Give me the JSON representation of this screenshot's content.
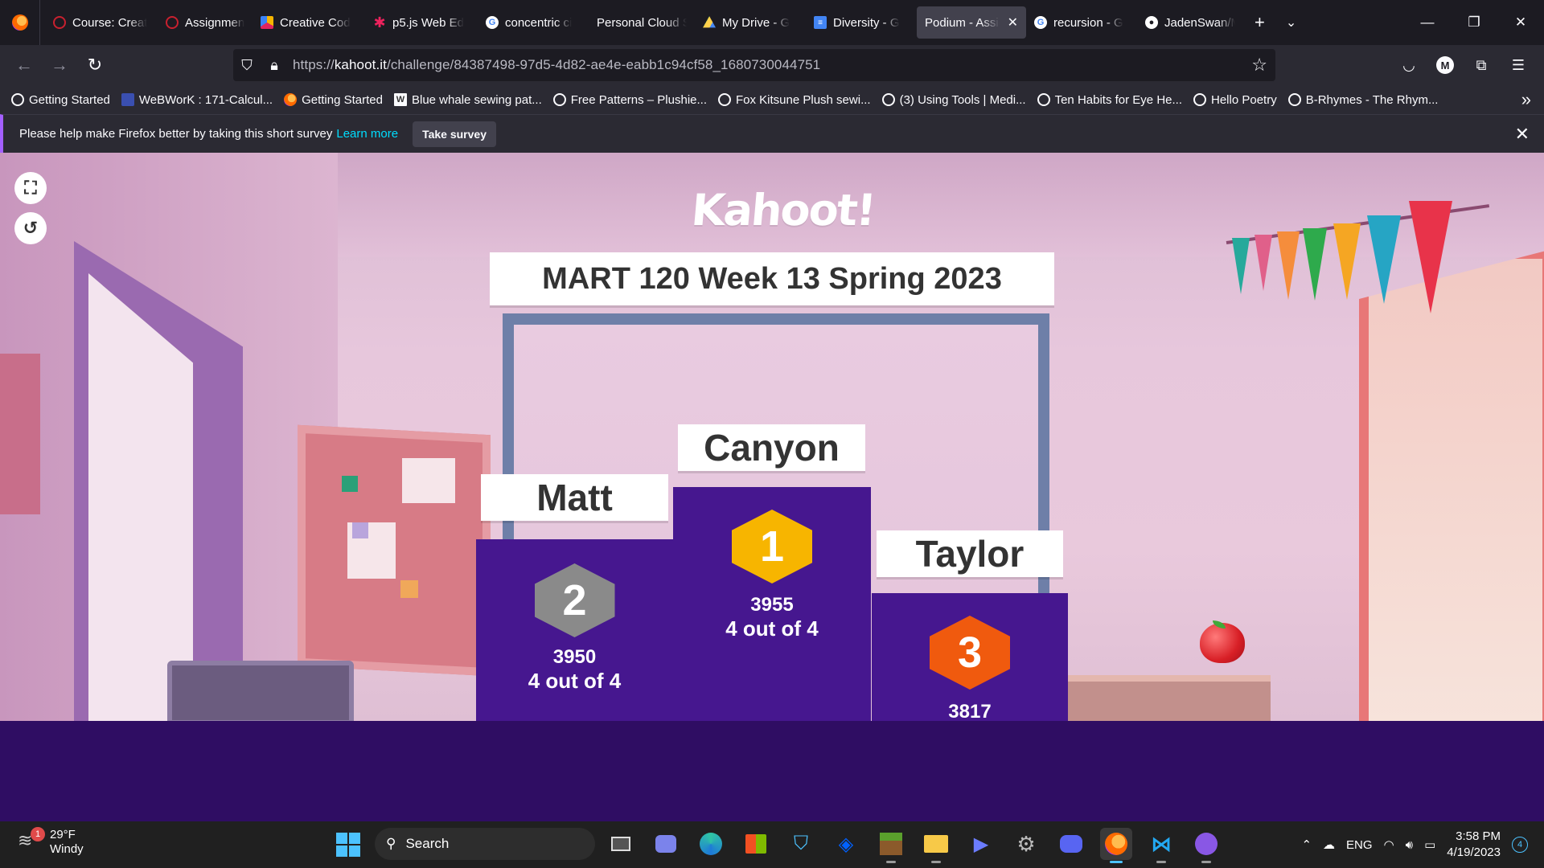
{
  "browser": {
    "tabs": [
      {
        "label": "Course: Creat",
        "icon": "canvas-icon",
        "color": "#c8202f"
      },
      {
        "label": "Assignment",
        "icon": "canvas-icon",
        "color": "#c8202f"
      },
      {
        "label": "Creative Cod",
        "icon": "colorful-icon",
        "color": "#f7b500"
      },
      {
        "label": "p5.js Web Ed",
        "icon": "p5js-star-icon",
        "color": "#ed225d"
      },
      {
        "label": "concentric ci",
        "icon": "google-icon",
        "color": "#ffffff"
      },
      {
        "label": "Personal Cloud St",
        "icon": "",
        "color": ""
      },
      {
        "label": "My Drive - G",
        "icon": "google-drive-icon",
        "color": "#1fa463"
      },
      {
        "label": "Diversity - G",
        "icon": "google-docs-icon",
        "color": "#4285f4"
      },
      {
        "label": "Podium - Assig",
        "icon": "",
        "color": "",
        "active": true
      },
      {
        "label": "recursion - G",
        "icon": "google-icon",
        "color": "#ffffff"
      },
      {
        "label": "JadenSwan/M",
        "icon": "github-icon",
        "color": "#ffffff"
      }
    ],
    "url_prefix": "https://",
    "url_domain": "kahoot.it",
    "url_path": "/challenge/84387498-97d5-4d82-ae4e-eabb1c94cf58_1680730044751",
    "avatar_letter": "M",
    "bookmarks": [
      {
        "label": "Getting Started",
        "icon": "globe-icon"
      },
      {
        "label": "WeBWorK : 171-Calcul...",
        "icon": "webwork-icon"
      },
      {
        "label": "Getting Started",
        "icon": "firefox-icon"
      },
      {
        "label": "Blue whale sewing pat...",
        "icon": "w-icon"
      },
      {
        "label": "Free Patterns – Plushie...",
        "icon": "globe-icon"
      },
      {
        "label": "Fox Kitsune Plush sewi...",
        "icon": "globe-icon"
      },
      {
        "label": "(3) Using Tools | Medi...",
        "icon": "globe-icon"
      },
      {
        "label": "Ten Habits for Eye He...",
        "icon": "globe-icon"
      },
      {
        "label": "Hello Poetry",
        "icon": "globe-icon"
      },
      {
        "label": "B-Rhymes - The Rhym...",
        "icon": "globe-icon"
      }
    ],
    "notice": {
      "text": "Please help make Firefox better by taking this short survey",
      "link": "Learn more",
      "button": "Take survey"
    }
  },
  "kahoot": {
    "logo": "Kahoot!",
    "title": "MART 120 Week 13 Spring 2023",
    "podium": {
      "first": {
        "name": "Canyon",
        "rank": "1",
        "score": "3955",
        "correct": "4 out of 4"
      },
      "second": {
        "name": "Matt",
        "rank": "2",
        "score": "3950",
        "correct": "4 out of 4"
      },
      "third": {
        "name": "Taylor",
        "rank": "3",
        "score": "3817",
        "correct": ""
      }
    }
  },
  "taskbar": {
    "weather_temp": "29°F",
    "weather_desc": "Windy",
    "weather_badge": "1",
    "search_label": "Search",
    "language": "ENG",
    "time": "3:58 PM",
    "date": "4/19/2023",
    "notifications": "4"
  }
}
